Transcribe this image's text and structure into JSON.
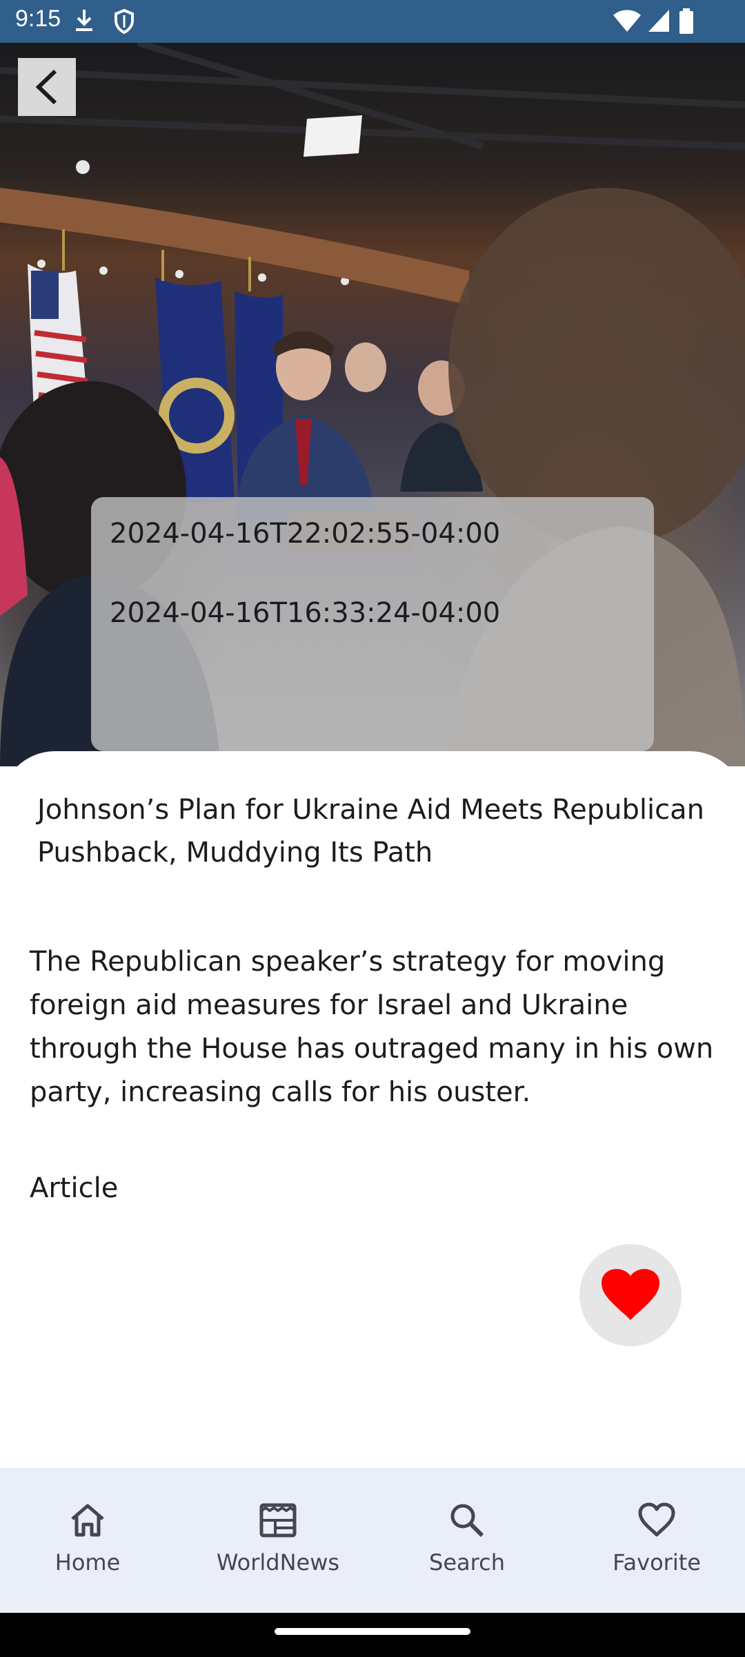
{
  "status_bar": {
    "time": "9:15",
    "icons": [
      "download-icon",
      "shield-icon",
      "wifi-icon",
      "signal-icon",
      "battery-icon"
    ]
  },
  "hero": {
    "image": "press-conference-photo",
    "back_icon": "chevron-left-icon"
  },
  "dates": {
    "published": "2024-04-16T22:02:55-04:00",
    "updated": "2024-04-16T16:33:24-04:00"
  },
  "article": {
    "headline": "Johnson’s Plan for Ukraine Aid Meets Republican Pushback, Muddying Its Path",
    "summary": "The Republican speaker’s strategy for moving foreign aid measures for Israel and Ukraine through the House has outraged many in his own party, increasing calls for his ouster.",
    "type_label": "Article",
    "favorite_icon": "heart-filled-icon",
    "favorite_color": "#ff0000"
  },
  "bottom_nav": {
    "items": [
      {
        "label": "Home",
        "icon": "home-icon"
      },
      {
        "label": "WorldNews",
        "icon": "newspaper-icon"
      },
      {
        "label": "Search",
        "icon": "search-icon"
      },
      {
        "label": "Favorite",
        "icon": "heart-outline-icon"
      }
    ]
  },
  "colors": {
    "status_bar": "#2f5f8a",
    "nav_background": "#e9eef7",
    "card_background": "#bebebe"
  }
}
